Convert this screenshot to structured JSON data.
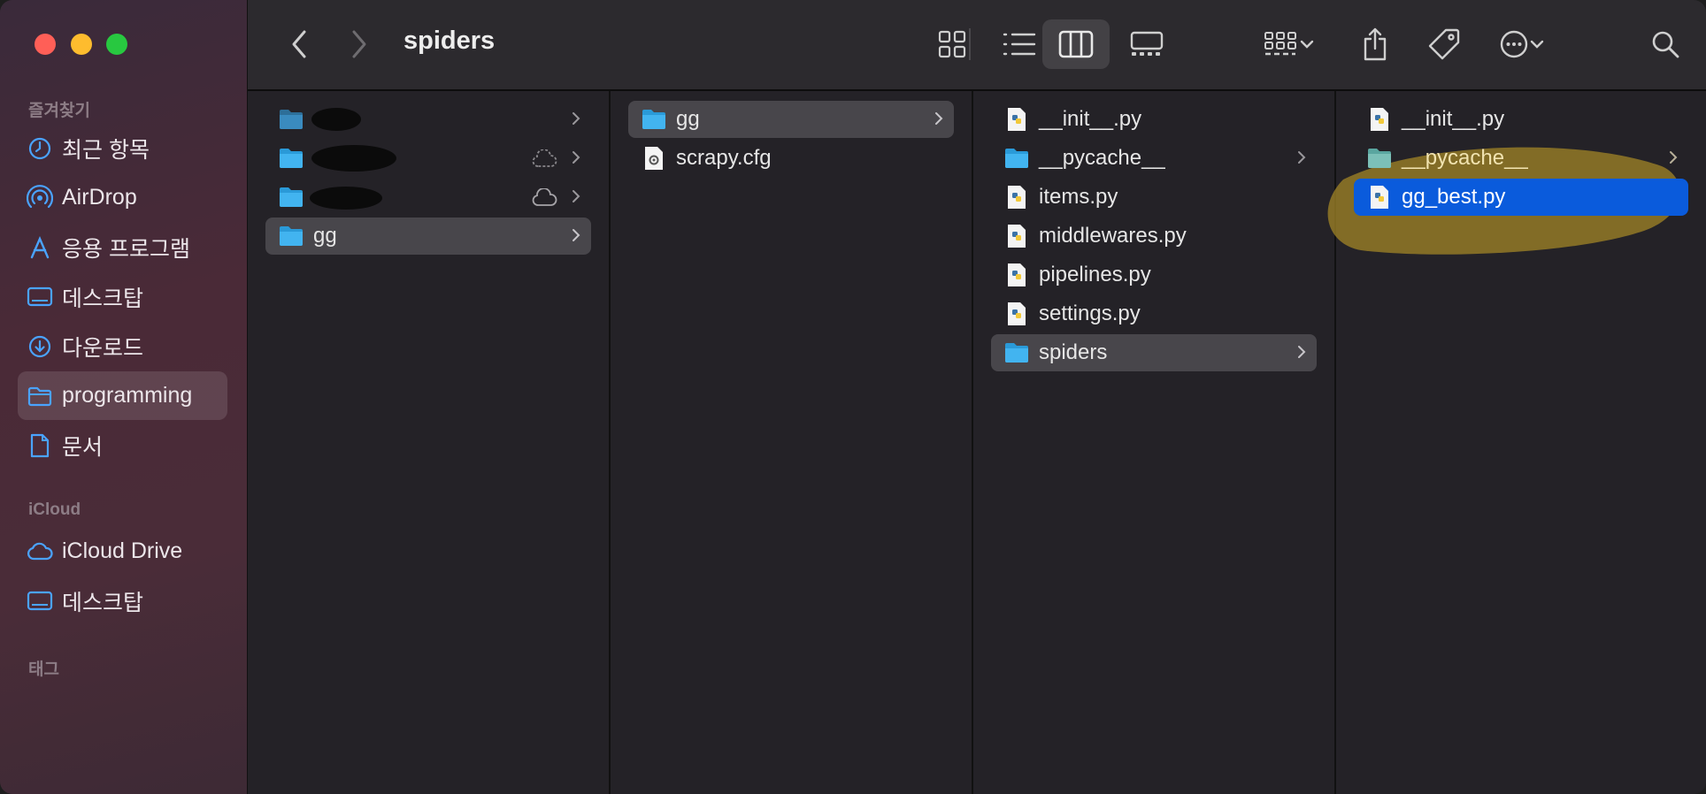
{
  "window": {
    "title": "spiders"
  },
  "sidebar": {
    "favorites_title": "즐겨찾기",
    "favorites": [
      {
        "label": "최근 항목",
        "icon": "clock-icon"
      },
      {
        "label": "AirDrop",
        "icon": "airdrop-icon"
      },
      {
        "label": "응용 프로그램",
        "icon": "applications-icon"
      },
      {
        "label": "데스크탑",
        "icon": "desktop-icon"
      },
      {
        "label": "다운로드",
        "icon": "download-icon"
      },
      {
        "label": "programming",
        "icon": "folder-icon",
        "active": true
      },
      {
        "label": "문서",
        "icon": "document-icon"
      }
    ],
    "icloud_title": "iCloud",
    "icloud": [
      {
        "label": "iCloud Drive",
        "icon": "cloud-icon"
      },
      {
        "label": "데스크탑",
        "icon": "desktop-icon"
      }
    ],
    "tags_title": "태그"
  },
  "columns": [
    {
      "items": [
        {
          "name": "",
          "type": "folder",
          "redacted": true,
          "chevron": true
        },
        {
          "name": "",
          "type": "folder",
          "redacted": true,
          "cloud": "dotted",
          "chevron": true
        },
        {
          "name": "",
          "type": "folder",
          "redacted": true,
          "cloud": "solid",
          "chevron": true
        },
        {
          "name": "gg",
          "type": "folder",
          "chevron": true,
          "state": "highlight"
        }
      ]
    },
    {
      "items": [
        {
          "name": "gg",
          "type": "folder",
          "chevron": true,
          "state": "highlight"
        },
        {
          "name": "scrapy.cfg",
          "type": "cfg-file"
        }
      ]
    },
    {
      "items": [
        {
          "name": "__init__.py",
          "type": "python-file"
        },
        {
          "name": "__pycache__",
          "type": "folder",
          "chevron": true
        },
        {
          "name": "items.py",
          "type": "python-file"
        },
        {
          "name": "middlewares.py",
          "type": "python-file"
        },
        {
          "name": "pipelines.py",
          "type": "python-file"
        },
        {
          "name": "settings.py",
          "type": "python-file"
        },
        {
          "name": "spiders",
          "type": "folder",
          "chevron": true,
          "state": "highlight"
        }
      ]
    },
    {
      "items": [
        {
          "name": "__init__.py",
          "type": "python-file"
        },
        {
          "name": "__pycache__",
          "type": "folder",
          "chevron": true
        },
        {
          "name": "gg_best.py",
          "type": "python-file",
          "state": "selected"
        }
      ]
    }
  ],
  "colors": {
    "selection": "#0a5bdc",
    "highlight": "#48464b",
    "folder": "#3fa8e8",
    "annotation": "#a88a2a"
  }
}
